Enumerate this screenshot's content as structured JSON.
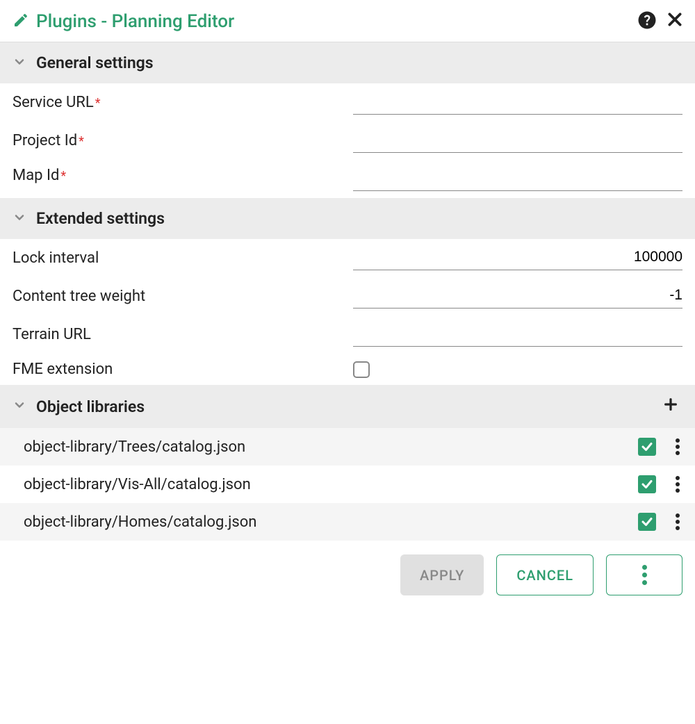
{
  "header": {
    "title": "Plugins - Planning Editor"
  },
  "sections": {
    "general": {
      "title": "General settings",
      "fields": {
        "service_url_label": "Service URL",
        "service_url_value": "",
        "project_id_label": "Project Id",
        "project_id_value": "",
        "map_id_label": "Map Id",
        "map_id_value": ""
      }
    },
    "extended": {
      "title": "Extended settings",
      "fields": {
        "lock_interval_label": "Lock interval",
        "lock_interval_value": "100000",
        "content_tree_weight_label": "Content tree weight",
        "content_tree_weight_value": "-1",
        "terrain_url_label": "Terrain URL",
        "terrain_url_value": "",
        "fme_extension_label": "FME extension",
        "fme_extension_checked": false
      }
    },
    "libraries": {
      "title": "Object libraries",
      "items": [
        {
          "path": "object-library/Trees/catalog.json",
          "checked": true
        },
        {
          "path": "object-library/Vis-All/catalog.json",
          "checked": true
        },
        {
          "path": "object-library/Homes/catalog.json",
          "checked": true
        }
      ]
    }
  },
  "footer": {
    "apply": "APPLY",
    "cancel": "CANCEL"
  }
}
